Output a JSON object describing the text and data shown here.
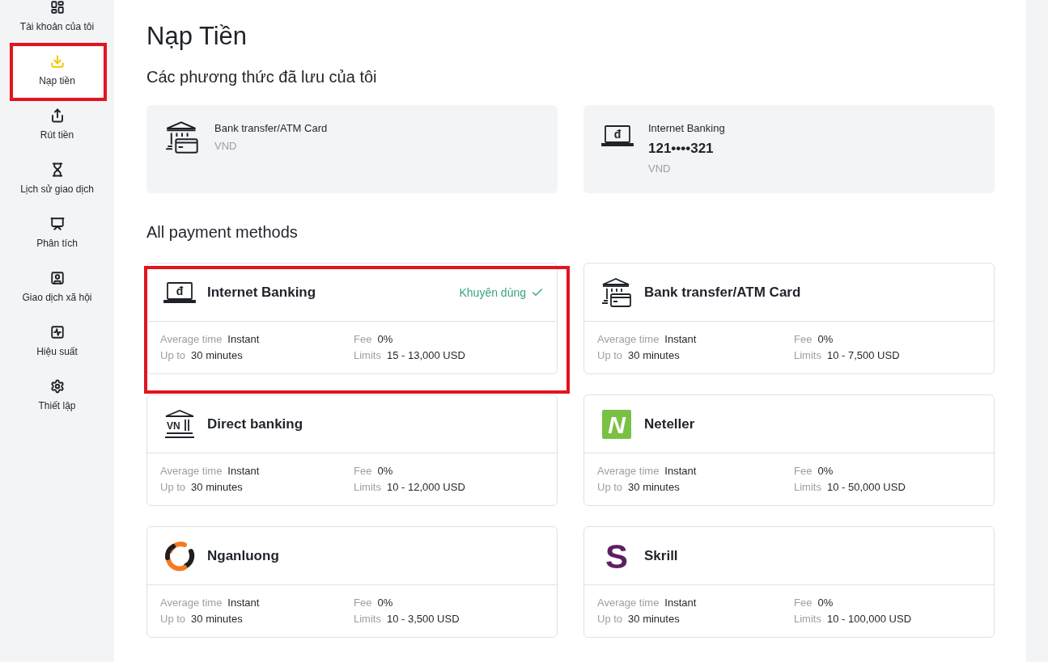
{
  "sidebar": {
    "items": [
      {
        "label": "Tài khoản của tôi",
        "selected": false,
        "highlighted": false
      },
      {
        "label": "Nạp tiền",
        "selected": true,
        "highlighted": true
      },
      {
        "label": "Rút tiền",
        "selected": false,
        "highlighted": false
      },
      {
        "label": "Lịch sử giao dịch",
        "selected": false,
        "highlighted": false
      },
      {
        "label": "Phân tích",
        "selected": false,
        "highlighted": false
      },
      {
        "label": "Giao dịch xã hội",
        "selected": false,
        "highlighted": false
      },
      {
        "label": "Hiệu suất",
        "selected": false,
        "highlighted": false
      },
      {
        "label": "Thiết lập",
        "selected": false,
        "highlighted": false
      }
    ]
  },
  "page_title": "Nạp Tiền",
  "saved_section": {
    "title": "Các phương thức đã lưu của tôi",
    "methods": [
      {
        "kind": "bank",
        "name": "Bank transfer/ATM Card",
        "currency": "VND"
      },
      {
        "kind": "laptop",
        "logo_text": "đ",
        "name": "Internet Banking",
        "account": "121••••321",
        "currency": "VND"
      }
    ]
  },
  "all_section": {
    "title": "All payment methods",
    "methods": [
      {
        "kind": "laptop",
        "logo_text": "đ",
        "name": "Internet Banking",
        "badge": "Khuyên dùng",
        "highlighted": true,
        "avg_label": "Average time",
        "avg_value": "Instant",
        "upto_label": "Up to",
        "upto_value": "30 minutes",
        "fee_label": "Fee",
        "fee_value": "0%",
        "limits_label": "Limits",
        "limits_value": "15 - 13,000 USD"
      },
      {
        "kind": "bank",
        "name": "Bank transfer/ATM Card",
        "highlighted": false,
        "avg_label": "Average time",
        "avg_value": "Instant",
        "upto_label": "Up to",
        "upto_value": "30 minutes",
        "fee_label": "Fee",
        "fee_value": "0%",
        "limits_label": "Limits",
        "limits_value": "10 - 7,500 USD"
      },
      {
        "kind": "vnbank",
        "logo_text": "VN",
        "name": "Direct banking",
        "highlighted": false,
        "avg_label": "Average time",
        "avg_value": "Instant",
        "upto_label": "Up to",
        "upto_value": "30 minutes",
        "fee_label": "Fee",
        "fee_value": "0%",
        "limits_label": "Limits",
        "limits_value": "10 - 12,000 USD"
      },
      {
        "kind": "neteller",
        "logo_text": "N",
        "name": "Neteller",
        "highlighted": false,
        "avg_label": "Average time",
        "avg_value": "Instant",
        "upto_label": "Up to",
        "upto_value": "30 minutes",
        "fee_label": "Fee",
        "fee_value": "0%",
        "limits_label": "Limits",
        "limits_value": "10 - 50,000 USD"
      },
      {
        "kind": "nganluong",
        "name": "Nganluong",
        "highlighted": false,
        "avg_label": "Average time",
        "avg_value": "Instant",
        "upto_label": "Up to",
        "upto_value": "30 minutes",
        "fee_label": "Fee",
        "fee_value": "0%",
        "limits_label": "Limits",
        "limits_value": "10 - 3,500 USD"
      },
      {
        "kind": "skrill",
        "logo_text": "S",
        "name": "Skrill",
        "highlighted": false,
        "avg_label": "Average time",
        "avg_value": "Instant",
        "upto_label": "Up to",
        "upto_value": "30 minutes",
        "fee_label": "Fee",
        "fee_value": "0%",
        "limits_label": "Limits",
        "limits_value": "10 - 100,000 USD"
      }
    ]
  }
}
